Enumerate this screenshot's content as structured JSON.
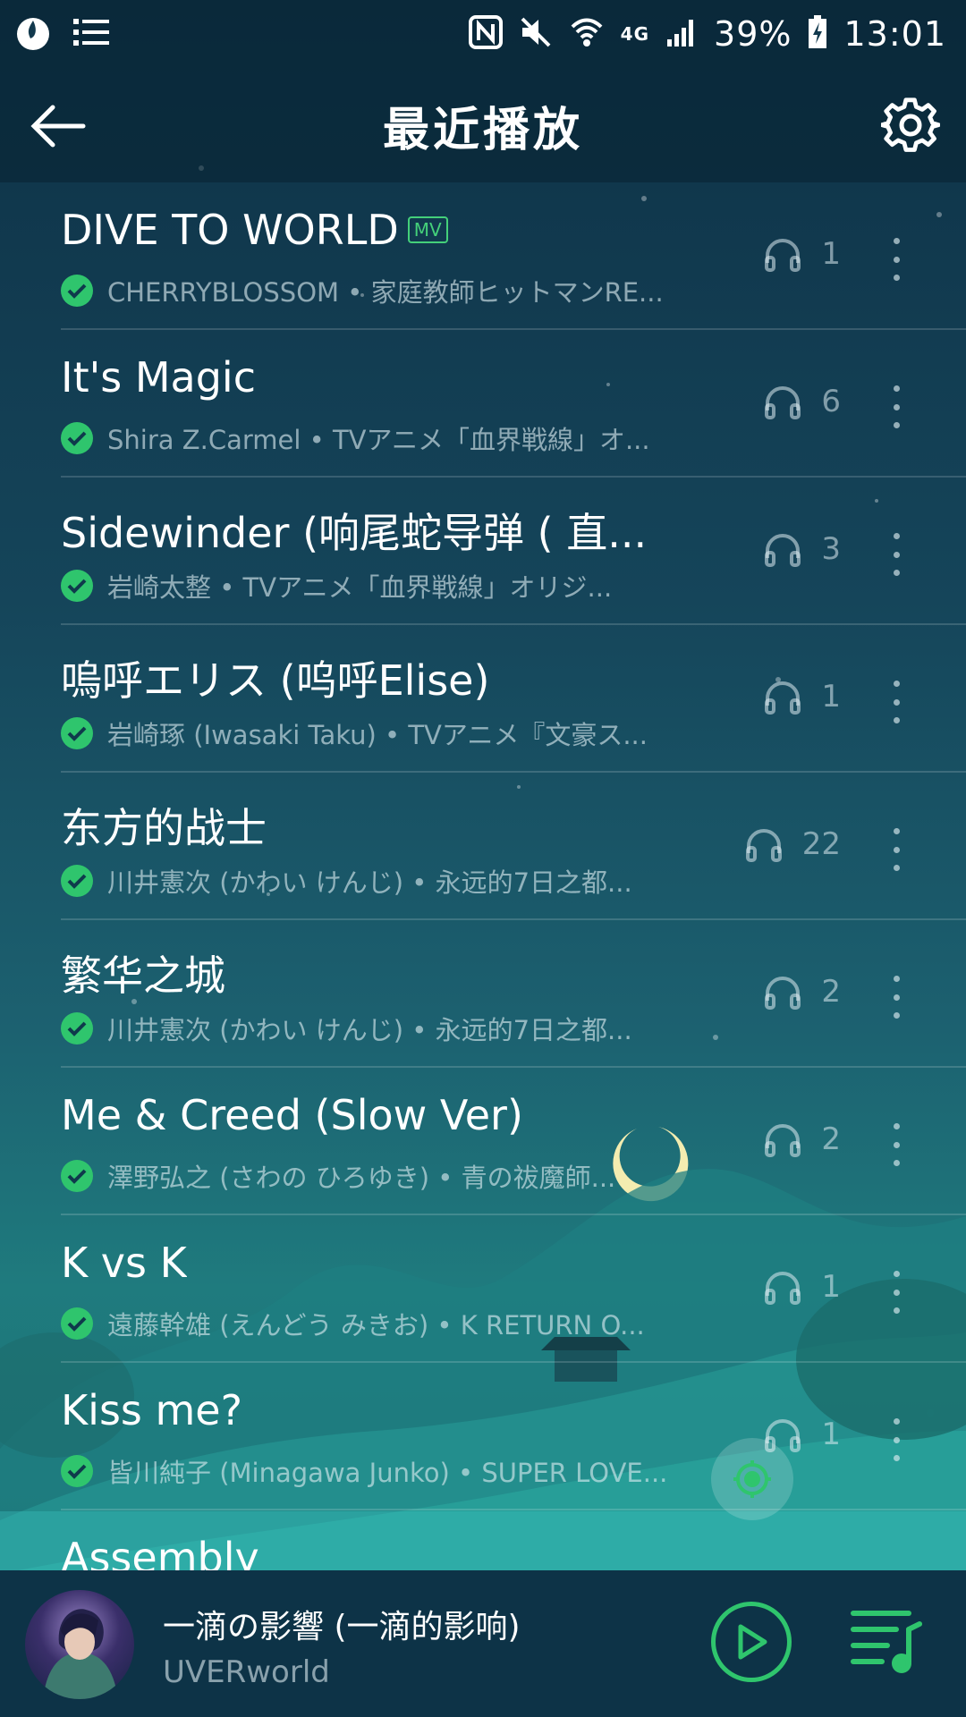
{
  "statusbar": {
    "network": "4G",
    "battery": "39%",
    "time": "13:01"
  },
  "header": {
    "title": "最近播放"
  },
  "songs": [
    {
      "title": "DIVE TO WORLD",
      "badge": "MV",
      "meta": "CHERRYBLOSSOM • 家庭教師ヒットマンRE...",
      "plays": "1"
    },
    {
      "title": "It's Magic",
      "badge": "",
      "meta": "Shira Z.Carmel • TVアニメ「血界戦線」オ...",
      "plays": "6"
    },
    {
      "title": "Sidewinder (响尾蛇导弹 ( 直...",
      "badge": "",
      "meta": "岩崎太整 • TVアニメ「血界戦線」オリジ...",
      "plays": "3"
    },
    {
      "title": "嗚呼エリス (呜呼Elise)",
      "badge": "",
      "meta": "岩崎琢 (Iwasaki Taku) • TVアニメ『文豪ス...",
      "plays": "1"
    },
    {
      "title": "东方的战士",
      "badge": "",
      "meta": "川井憲次 (かわい けんじ) • 永远的7日之都...",
      "plays": "22"
    },
    {
      "title": "繁华之城",
      "badge": "",
      "meta": "川井憲次 (かわい けんじ) • 永远的7日之都...",
      "plays": "2"
    },
    {
      "title": "Me & Creed (Slow Ver)",
      "badge": "",
      "meta": "澤野弘之 (さわの ひろゆき) • 青の祓魔師...",
      "plays": "2"
    },
    {
      "title": "K vs K",
      "badge": "",
      "meta": "遠藤幹雄 (えんどう みきお) • K RETURN O...",
      "plays": "1"
    },
    {
      "title": "Kiss me?",
      "badge": "",
      "meta": "皆川純子 (Minagawa Junko) • SUPER LOVE...",
      "plays": "1"
    },
    {
      "title": "Assembly",
      "badge": "",
      "meta": "",
      "plays": ""
    }
  ],
  "player": {
    "song": "一滴の影響 (一滴的影响)",
    "artist": "UVERworld"
  },
  "colors": {
    "accent": "#2fc56d",
    "bar": "#0d3347"
  }
}
